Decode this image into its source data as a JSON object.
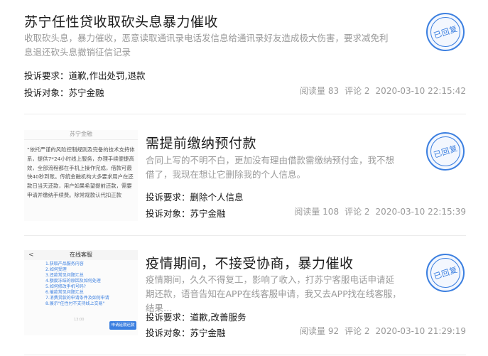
{
  "items": [
    {
      "title": "苏宁任性贷收取砍头息暴力催收",
      "desc": "收取砍头息，暴力催收，恶意读取通讯录电话发信息给通讯录好友造成极大伤害，要求减免利息退还砍头息撤销征信记录",
      "demand_label": "投诉要求：",
      "demand": "道歉,作出处罚,退款",
      "target_label": "投诉对象：",
      "target": "苏宁金融",
      "views": "阅读量 83",
      "comments": "评论 2",
      "time": "2020-03-10 22:15:42",
      "stamp": "已回复"
    },
    {
      "title": "需提前缴纳预付款",
      "desc": "合同上写的不明不白，更加没有理由借款需缴纳预付金，我不想借了，我现在想让它删除我的个人信息。",
      "demand_label": "投诉要求：",
      "demand": "删除个人信息",
      "target_label": "投诉对象：",
      "target": "苏宁金融",
      "views": "阅读量 108",
      "comments": "评论 2",
      "time": "2020-03-10 22:15:39",
      "stamp": "已回复",
      "thumb_head": "苏宁金融",
      "thumb_text": "“依托严谨的风险控制规则及完备的技术支持体系，提供7*24小时线上服务，办理手续便捷高效，全部流程都在手机上操作完成，借款可最快40秒到账。传统金融机构大多要求用户在还款日当天还款，用户如果希望提前还款，需要申请并缴纳手续费。除常规款认代扣正款"
    },
    {
      "title": "疫情期间，不接受协商，暴力催收",
      "desc": "疫情期间，久久不得复工，影响了收入，打苏宁客服电话申请延期还款，语音告知在APP在线客服申请，我又去APP找在线客服，结果…",
      "demand_label": "投诉要求：",
      "demand": "道歉,改善服务",
      "target_label": "投诉对象：",
      "target": "苏宁金融",
      "views": "阅读量 92",
      "comments": "评论 2",
      "time": "2020-03-10 21:29:19",
      "stamp": "已回复",
      "thumb_back": "<",
      "thumb_head": "在线客服",
      "thumb_list": [
        "1.获取产品服务内容",
        "2.如何受理",
        "3.还款常见问题汇总",
        "4.额度冻结的原因及如何处理",
        "5.如何修改手机号码?",
        "6.催款常见问题汇总",
        "7.消费贷款的申请条件及如何申请",
        "8.展示\"任性付不支持线上交易\""
      ],
      "thumb_small": "13:00",
      "thumb_btn": "申请延期还款"
    }
  ]
}
